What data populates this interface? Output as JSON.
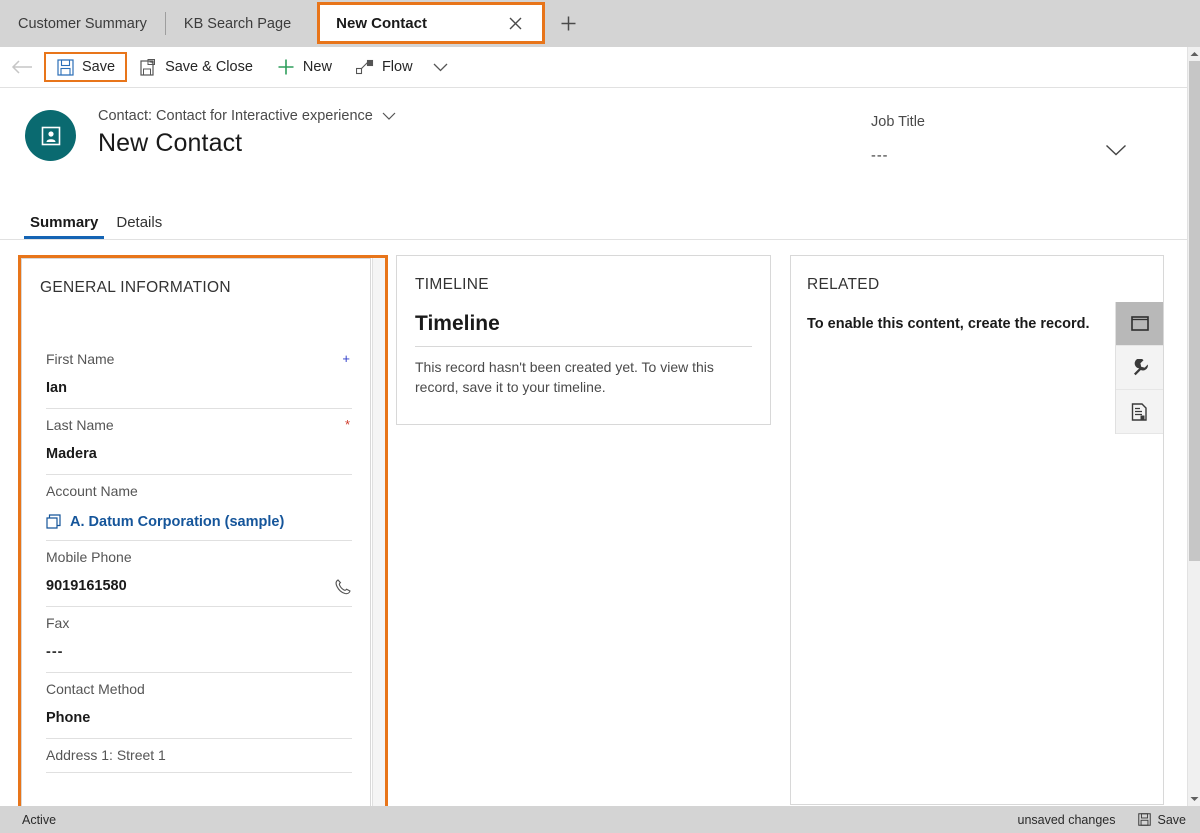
{
  "tabs": {
    "inactive": [
      {
        "label": "Customer Summary"
      },
      {
        "label": "KB Search Page"
      }
    ],
    "active": {
      "label": "New Contact",
      "close_icon": "close-icon"
    },
    "new_tab_icon": "plus-icon"
  },
  "commandbar": {
    "back_icon": "back-arrow-icon",
    "buttons": [
      {
        "label": "Save",
        "icon": "save-icon",
        "highlighted": true
      },
      {
        "label": "Save & Close",
        "icon": "save-and-close-icon",
        "highlighted": false
      },
      {
        "label": "New",
        "icon": "plus-icon",
        "highlighted": false
      },
      {
        "label": "Flow",
        "icon": "flow-icon",
        "highlighted": false
      }
    ],
    "overflow_icon": "chevron-down-icon"
  },
  "record_header": {
    "avatar_icon": "contact-card-icon",
    "entity_label": "Contact: Contact for Interactive experience",
    "entity_chevron": "chevron-down-icon",
    "title": "New Contact",
    "job_title_label": "Job Title",
    "job_title_value": "---",
    "expand_icon": "chevron-down-icon"
  },
  "form_tabs": [
    {
      "label": "Summary",
      "active": true
    },
    {
      "label": "Details",
      "active": false
    }
  ],
  "general_information": {
    "title": "GENERAL INFORMATION",
    "highlighted": true,
    "fields": [
      {
        "label": "First Name",
        "value": "Ian",
        "marker": "+",
        "marker_type": "recommended",
        "kind": "text"
      },
      {
        "label": "Last Name",
        "value": "Madera",
        "marker": "*",
        "marker_type": "required",
        "kind": "text"
      },
      {
        "label": "Account Name",
        "value": "A. Datum Corporation (sample)",
        "marker": "",
        "marker_type": "",
        "kind": "lookup",
        "icon": "account-lookup-icon"
      },
      {
        "label": "Mobile Phone",
        "value": "9019161580",
        "marker": "",
        "marker_type": "",
        "kind": "phone",
        "trail_icon": "phone-icon"
      },
      {
        "label": "Fax",
        "value": "---",
        "marker": "",
        "marker_type": "",
        "kind": "text"
      },
      {
        "label": "Contact Method",
        "value": "Phone",
        "marker": "",
        "marker_type": "",
        "kind": "text"
      },
      {
        "label": "Address 1: Street 1",
        "value": "",
        "marker": "",
        "marker_type": "",
        "kind": "text"
      }
    ]
  },
  "timeline": {
    "title": "TIMELINE",
    "heading": "Timeline",
    "body": "This record hasn't been created yet.  To view this record, save it to your timeline."
  },
  "related": {
    "title": "RELATED",
    "body": "To enable this content, create the record.",
    "rail": [
      {
        "icon": "panel-window-icon",
        "active": true
      },
      {
        "icon": "wrench-icon",
        "active": false
      },
      {
        "icon": "document-icon",
        "active": false
      }
    ]
  },
  "statusbar": {
    "state": "Active",
    "unsaved_text": "unsaved changes",
    "save_label": "Save",
    "save_icon": "save-icon"
  },
  "colors": {
    "highlight_orange": "#e8751a",
    "accent_blue": "#1464b4",
    "avatar_teal": "#0a6a70",
    "link_blue": "#15559a",
    "required_red": "#d03a2a",
    "recommended_blue": "#2b39c8",
    "new_green": "#2e9e5b",
    "chrome_gray": "#d4d4d4"
  }
}
